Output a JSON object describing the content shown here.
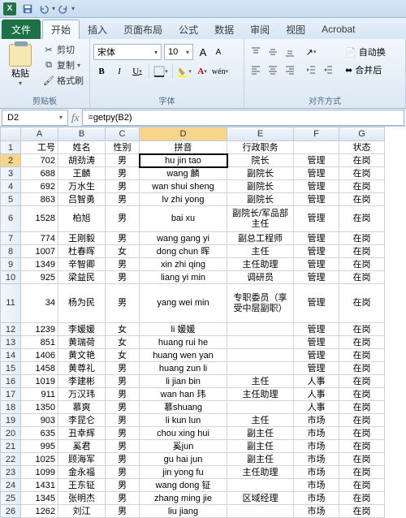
{
  "qat": {
    "app_icon": "X"
  },
  "tabs": {
    "file": "文件",
    "home": "开始",
    "insert": "插入",
    "layout": "页面布局",
    "formulas": "公式",
    "data": "数据",
    "review": "审阅",
    "view": "视图",
    "acrobat": "Acrobat"
  },
  "ribbon": {
    "paste": "粘贴",
    "cut": "剪切",
    "copy": "复制",
    "format_painter": "格式刷",
    "clipboard_group": "剪贴板",
    "font_name": "宋体",
    "font_size": "10",
    "grow": "A",
    "shrink": "A",
    "bold": "B",
    "italic": "I",
    "underline": "U",
    "font_group": "字体",
    "wrap": "自动换",
    "merge": "合并后",
    "align_group": "对齐方式"
  },
  "namebox": "D2",
  "formula": "=getpy(B2)",
  "columns": [
    "",
    "A",
    "B",
    "C",
    "D",
    "E",
    "F",
    "G"
  ],
  "rows": [
    {
      "n": "1",
      "h": 1,
      "a": "工号",
      "b": "姓名",
      "c": "性别",
      "d": "拼音",
      "e": "行政职务",
      "f": "",
      "g": "状态"
    },
    {
      "n": "2",
      "h": 1,
      "a": "702",
      "b": "胡劲涛",
      "c": "男",
      "d": "hu jin tao",
      "e": "院长",
      "f": "管理",
      "g": "在岗",
      "sel": true
    },
    {
      "n": "3",
      "h": 1,
      "a": "688",
      "b": "王麟",
      "c": "男",
      "d": "wang 麟",
      "e": "副院长",
      "f": "管理",
      "g": "在岗"
    },
    {
      "n": "4",
      "h": 1,
      "a": "692",
      "b": "万水生",
      "c": "男",
      "d": "wan shui sheng",
      "e": "副院长",
      "f": "管理",
      "g": "在岗"
    },
    {
      "n": "5",
      "h": 1,
      "a": "863",
      "b": "吕智勇",
      "c": "男",
      "d": "lv zhi yong",
      "e": "副院长",
      "f": "管理",
      "g": "在岗"
    },
    {
      "n": "6",
      "h": 2,
      "a": "1528",
      "b": "柏旭",
      "c": "男",
      "d": "bai xu",
      "e": "副院长/军品部主任",
      "f": "管理",
      "g": "在岗"
    },
    {
      "n": "7",
      "h": 1,
      "a": "774",
      "b": "王刚毅",
      "c": "男",
      "d": "wang gang yi",
      "e": "副总工程师",
      "f": "管理",
      "g": "在岗"
    },
    {
      "n": "8",
      "h": 1,
      "a": "1007",
      "b": "杜春晖",
      "c": "女",
      "d": "dong chun 晖",
      "e": "主任",
      "f": "管理",
      "g": "在岗"
    },
    {
      "n": "9",
      "h": 1,
      "a": "1349",
      "b": "辛智卿",
      "c": "男",
      "d": "xin zhi qing",
      "e": "主任助理",
      "f": "管理",
      "g": "在岗"
    },
    {
      "n": "10",
      "h": 1,
      "a": "925",
      "b": "梁益民",
      "c": "男",
      "d": "liang yi min",
      "e": "调研员",
      "f": "管理",
      "g": "在岗"
    },
    {
      "n": "11",
      "h": 3,
      "a": "34",
      "b": "杨为民",
      "c": "男",
      "d": "yang wei min",
      "e": "专职委员（享受中层副职）",
      "f": "管理",
      "g": "在岗"
    },
    {
      "n": "12",
      "h": 1,
      "a": "1239",
      "b": "李媛媛",
      "c": "女",
      "d": "li 媛媛",
      "e": "",
      "f": "管理",
      "g": "在岗"
    },
    {
      "n": "13",
      "h": 1,
      "a": "851",
      "b": "黄瑞荷",
      "c": "女",
      "d": "huang rui he",
      "e": "",
      "f": "管理",
      "g": "在岗"
    },
    {
      "n": "14",
      "h": 1,
      "a": "1406",
      "b": "黄文艳",
      "c": "女",
      "d": "huang wen yan",
      "e": "",
      "f": "管理",
      "g": "在岗"
    },
    {
      "n": "15",
      "h": 1,
      "a": "1458",
      "b": "黄尊礼",
      "c": "男",
      "d": "huang zun li",
      "e": "",
      "f": "管理",
      "g": "在岗"
    },
    {
      "n": "16",
      "h": 1,
      "a": "1019",
      "b": "李建彬",
      "c": "男",
      "d": "li jian bin",
      "e": "主任",
      "f": "人事",
      "g": "在岗"
    },
    {
      "n": "17",
      "h": 1,
      "a": "911",
      "b": "万汉玮",
      "c": "男",
      "d": "wan han 玮",
      "e": "主任助理",
      "f": "人事",
      "g": "在岗"
    },
    {
      "n": "18",
      "h": 1,
      "a": "1350",
      "b": "慕爽",
      "c": "男",
      "d": "慕shuang",
      "e": "",
      "f": "人事",
      "g": "在岗"
    },
    {
      "n": "19",
      "h": 1,
      "a": "903",
      "b": "李昆仑",
      "c": "男",
      "d": "li kun lun",
      "e": "主任",
      "f": "市场",
      "g": "在岗"
    },
    {
      "n": "20",
      "h": 1,
      "a": "635",
      "b": "丑幸辉",
      "c": "男",
      "d": "chou xing hui",
      "e": "副主任",
      "f": "市场",
      "g": "在岗"
    },
    {
      "n": "21",
      "h": 1,
      "a": "995",
      "b": "奚君",
      "c": "男",
      "d": "奚jun",
      "e": "副主任",
      "f": "市场",
      "g": "在岗"
    },
    {
      "n": "22",
      "h": 1,
      "a": "1025",
      "b": "顾海军",
      "c": "男",
      "d": "gu hai jun",
      "e": "副主任",
      "f": "市场",
      "g": "在岗"
    },
    {
      "n": "23",
      "h": 1,
      "a": "1099",
      "b": "金永福",
      "c": "男",
      "d": "jin yong fu",
      "e": "主任助理",
      "f": "市场",
      "g": "在岗"
    },
    {
      "n": "24",
      "h": 1,
      "a": "1431",
      "b": "王东钲",
      "c": "男",
      "d": "wang dong 钲",
      "e": "",
      "f": "市场",
      "g": "在岗"
    },
    {
      "n": "25",
      "h": 1,
      "a": "1345",
      "b": "张明杰",
      "c": "男",
      "d": "zhang ming jie",
      "e": "区域经理",
      "f": "市场",
      "g": "在岗"
    },
    {
      "n": "26",
      "h": 1,
      "a": "1262",
      "b": "刘江",
      "c": "男",
      "d": "liu jiang",
      "e": "",
      "f": "市场",
      "g": "在岗"
    }
  ]
}
